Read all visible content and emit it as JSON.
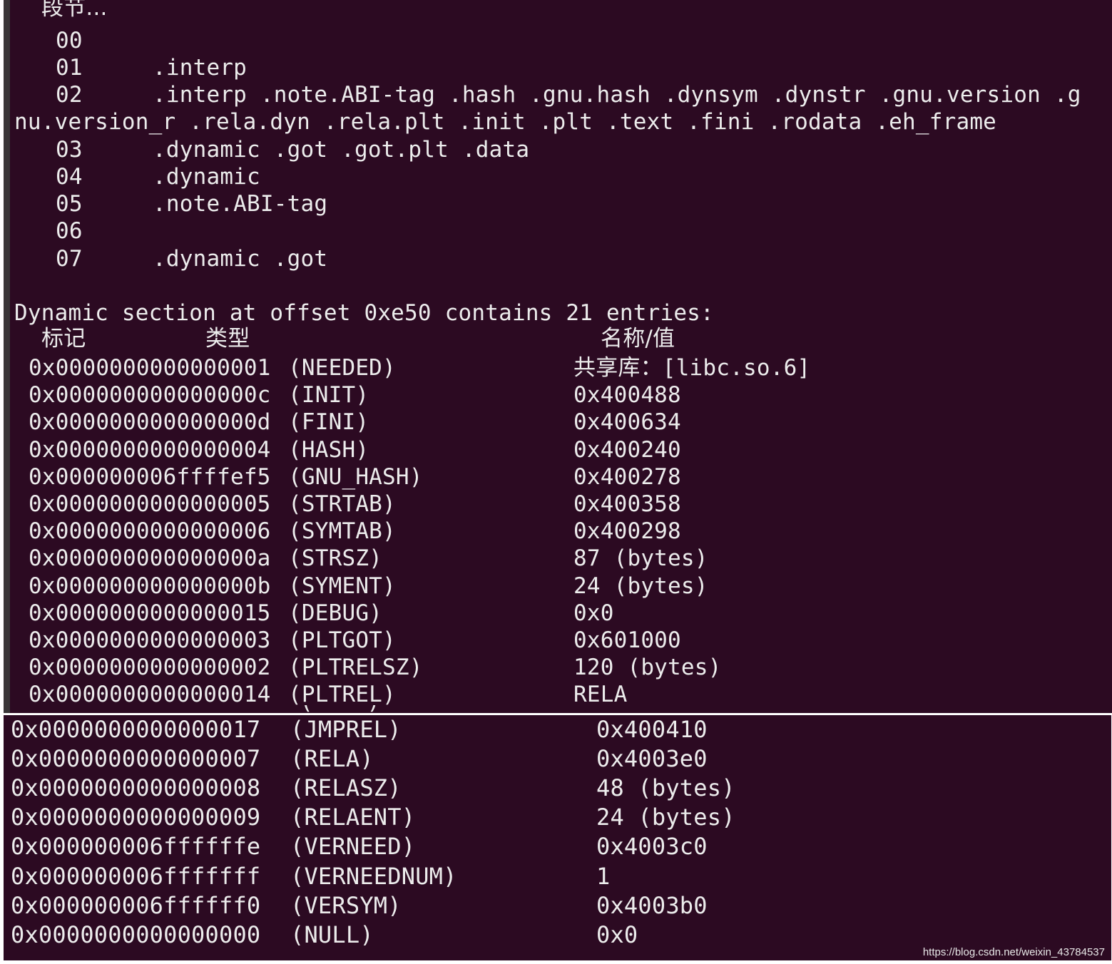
{
  "terminal": {
    "segment_header": "段节...",
    "segments": [
      {
        "index": "00",
        "sections": ""
      },
      {
        "index": "01",
        "sections": ".interp"
      },
      {
        "index": "02",
        "sections": ".interp .note.ABI-tag .hash .gnu.hash .dynsym .dynstr .gnu.version .g"
      },
      {
        "index": "03",
        "sections": ".dynamic .got .got.plt .data"
      },
      {
        "index": "04",
        "sections": ".dynamic"
      },
      {
        "index": "05",
        "sections": ".note.ABI-tag"
      },
      {
        "index": "06",
        "sections": ""
      },
      {
        "index": "07",
        "sections": ".dynamic .got"
      }
    ],
    "segment_02_wrap": "nu.version_r .rela.dyn .rela.plt .init .plt .text .fini .rodata .eh_frame",
    "dynamic_header": "Dynamic section at offset 0xe50 contains 21 entries:",
    "columns": {
      "tag": "标记",
      "type": "类型",
      "value": "名称/值"
    },
    "entries_top": [
      {
        "tag": "0x0000000000000001",
        "type": "(NEEDED)",
        "value": "共享库：[libc.so.6]"
      },
      {
        "tag": "0x000000000000000c",
        "type": "(INIT)",
        "value": "0x400488"
      },
      {
        "tag": "0x000000000000000d",
        "type": "(FINI)",
        "value": "0x400634"
      },
      {
        "tag": "0x0000000000000004",
        "type": "(HASH)",
        "value": "0x400240"
      },
      {
        "tag": "0x000000006ffffef5",
        "type": "(GNU_HASH)",
        "value": "0x400278"
      },
      {
        "tag": "0x0000000000000005",
        "type": "(STRTAB)",
        "value": "0x400358"
      },
      {
        "tag": "0x0000000000000006",
        "type": "(SYMTAB)",
        "value": "0x400298"
      },
      {
        "tag": "0x000000000000000a",
        "type": "(STRSZ)",
        "value": "87 (bytes)"
      },
      {
        "tag": "0x000000000000000b",
        "type": "(SYMENT)",
        "value": "24 (bytes)"
      },
      {
        "tag": "0x0000000000000015",
        "type": "(DEBUG)",
        "value": "0x0"
      },
      {
        "tag": "0x0000000000000003",
        "type": "(PLTGOT)",
        "value": "0x601000"
      },
      {
        "tag": "0x0000000000000002",
        "type": "(PLTRELSZ)",
        "value": "120 (bytes)"
      },
      {
        "tag": "0x0000000000000014",
        "type": "(PLTREL)",
        "value": "RELA"
      }
    ],
    "entries_bottom": [
      {
        "tag": "0x0000000000000017",
        "type": "(JMPREL)",
        "value": "0x400410"
      },
      {
        "tag": "0x0000000000000007",
        "type": "(RELA)",
        "value": "0x4003e0"
      },
      {
        "tag": "0x0000000000000008",
        "type": "(RELASZ)",
        "value": "48 (bytes)"
      },
      {
        "tag": "0x0000000000000009",
        "type": "(RELAENT)",
        "value": "24 (bytes)"
      },
      {
        "tag": "0x000000006ffffffe",
        "type": "(VERNEED)",
        "value": "0x4003c0"
      },
      {
        "tag": "0x000000006fffffff",
        "type": "(VERNEEDNUM)",
        "value": "1"
      },
      {
        "tag": "0x000000006ffffff0",
        "type": "(VERSYM)",
        "value": "0x4003b0"
      },
      {
        "tag": "0x0000000000000000",
        "type": "(NULL)",
        "value": "0x0"
      }
    ]
  },
  "watermark": "https://blog.csdn.net/weixin_43784537",
  "colors": {
    "terminal_bg": "#2c0a22",
    "terminal_fg": "#ececec"
  }
}
